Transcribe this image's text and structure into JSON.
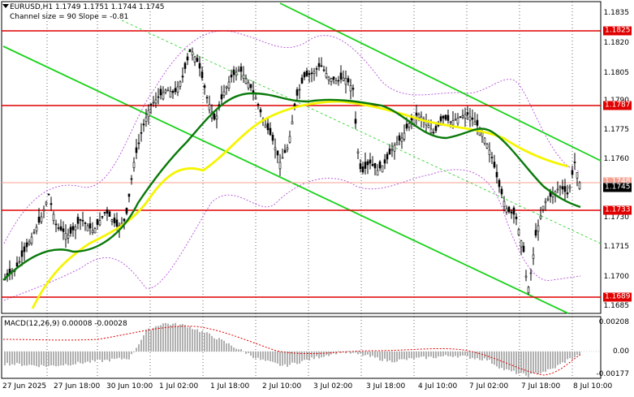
{
  "header": {
    "symbol_line": "EURUSD,H1  1.1749 1.1751 1.1744 1.1745",
    "channel_line": "Channel size = 90 Slope = -0.81"
  },
  "macd": {
    "label": "MACD(12,26,9) 0.00008 -0.00028",
    "axis": [
      "0.00208",
      "0.00",
      "-0.00177"
    ]
  },
  "price_axis": [
    "1.1835",
    "1.1820",
    "1.1805",
    "1.1790",
    "1.1775",
    "1.1760",
    "1.1730",
    "1.1715",
    "1.1700",
    "1.1685"
  ],
  "price_tags": {
    "r1825": "1.1825",
    "r1787": "1.1787",
    "r1748": "1.1748",
    "current": "1.1745",
    "r1733": "1.1733",
    "r1689": "1.1689"
  },
  "dates": [
    "27 Jun 2025",
    "27 Jun 18:00",
    "30 Jun 10:00",
    "1 Jul 02:00",
    "1 Jul 18:00",
    "2 Jul 10:00",
    "3 Jul 02:00",
    "3 Jul 18:00",
    "4 Jul 10:00",
    "7 Jul 02:00",
    "7 Jul 18:00",
    "8 Jul 10:00"
  ],
  "colors": {
    "level_line": "#e00000",
    "channel": "#19d219",
    "ma_fast": "#0a7a0a",
    "ma_slow": "#f5f500",
    "bollinger": "#b44fd8",
    "macd_hist": "#b0b0b0",
    "macd_signal": "#e00000"
  }
}
